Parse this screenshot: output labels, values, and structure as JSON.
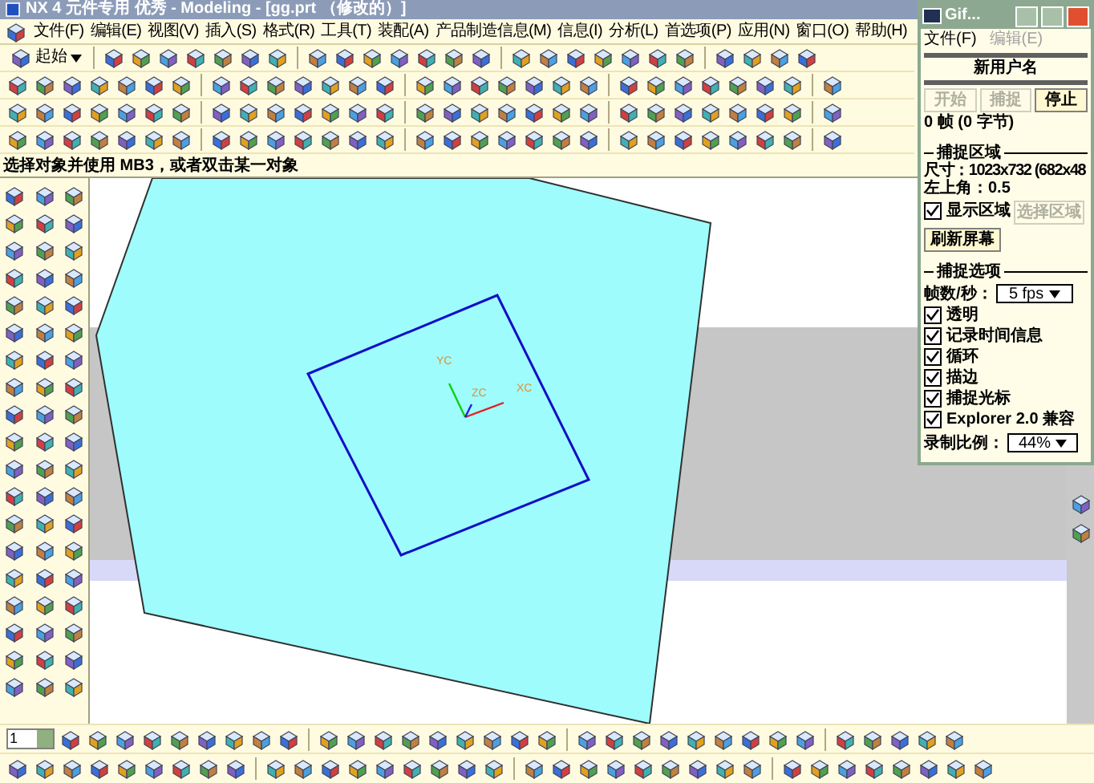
{
  "window": {
    "title": "NX 4 元件专用  优秀 - Modeling - [gg.prt （修改的）]"
  },
  "menu": [
    "文件(F)",
    "编辑(E)",
    "视图(V)",
    "插入(S)",
    "格式(R)",
    "工具(T)",
    "装配(A)",
    "产品制造信息(M)",
    "信息(I)",
    "分析(L)",
    "首选项(P)",
    "应用(N)",
    "窗口(O)",
    "帮助(H)"
  ],
  "toolbar": {
    "start_button": "起始"
  },
  "status_line": "选择对象并使用 MB3，或者双击某一对象",
  "viewport": {
    "axis_labels": [
      "YC",
      "ZC",
      "XC"
    ]
  },
  "bottom_toolbar": {
    "layer_field": "1"
  },
  "capture_window": {
    "title": "Gif...",
    "menu": [
      {
        "label": "文件(F)",
        "disabled": false
      },
      {
        "label": "编辑(E)",
        "disabled": true
      }
    ],
    "name": "新用户名",
    "buttons": [
      {
        "label": "开始",
        "disabled": true
      },
      {
        "label": "捕捉",
        "disabled": true
      },
      {
        "label": "停止",
        "disabled": false
      }
    ],
    "frame_count": "0 帧 (0 字节)",
    "area_group": "捕捉区域",
    "size": "尺寸：1023x732 (682x48",
    "top_left": "左上角：0.5",
    "show_area": {
      "label": "显示区域",
      "checked": true
    },
    "select_area_button": {
      "label": "选择区域",
      "disabled": true
    },
    "refresh_button": "刷新屏幕",
    "options_group": "捕捉选项",
    "fps": {
      "label": "帧数/秒：",
      "value": "5 fps"
    },
    "options": [
      {
        "label": "透明",
        "checked": true
      },
      {
        "label": "记录时间信息",
        "checked": true
      },
      {
        "label": "循环",
        "checked": true
      },
      {
        "label": "描边",
        "checked": true
      },
      {
        "label": "捕捉光标",
        "checked": true
      },
      {
        "label": "Explorer 2.0 兼容",
        "checked": true
      }
    ],
    "scale": {
      "label": "录制比例：",
      "value": "44%"
    }
  }
}
